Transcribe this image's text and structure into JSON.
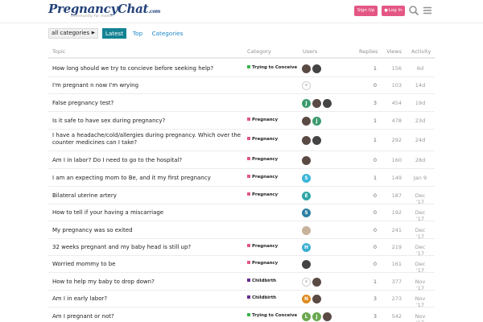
{
  "header": {
    "logo_main": "PregnancyChat",
    "logo_tld": ".com",
    "logo_tagline": "community for moms",
    "signup_label": "Sign Up",
    "login_label": "Log In"
  },
  "nav": {
    "category_dropdown": "all categories",
    "tabs": [
      "Latest",
      "Top",
      "Categories"
    ]
  },
  "columns": {
    "topic": "Topic",
    "category": "Category",
    "users": "Users",
    "replies": "Replies",
    "views": "Views",
    "activity": "Activity"
  },
  "colors": {
    "accent": "#138393",
    "button": "#e45785",
    "link": "#1e88c7",
    "cat_trying": "#3ab54a",
    "cat_pregnancy": "#e45785",
    "cat_childbirth": "#652d90"
  },
  "topics": [
    {
      "title": "How long should we try to concieve before seeking help?",
      "category": "Trying to Conceive",
      "cat_color": "#3ab54a",
      "users": [
        {
          "type": "photo",
          "letter": ""
        },
        {
          "type": "photo2",
          "letter": ""
        }
      ],
      "replies": "1",
      "views": "156",
      "activity": "6d"
    },
    {
      "title": "I'm pregnant n now I'm wrying",
      "category": "",
      "cat_color": "",
      "users": [
        {
          "type": "blank",
          "letter": ""
        }
      ],
      "replies": "0",
      "views": "103",
      "activity": "14d"
    },
    {
      "title": "False pregnancy test?",
      "category": "",
      "cat_color": "",
      "users": [
        {
          "type": "letter",
          "letter": "J",
          "color": "#3d9b6f"
        },
        {
          "type": "photo",
          "letter": ""
        },
        {
          "type": "photo2",
          "letter": ""
        }
      ],
      "replies": "3",
      "views": "454",
      "activity": "19d"
    },
    {
      "title": "Is it safe to have sex during pregnancy?",
      "category": "Pregnancy",
      "cat_color": "#e45785",
      "users": [
        {
          "type": "photo",
          "letter": ""
        },
        {
          "type": "letter",
          "letter": "J",
          "color": "#3d9b6f"
        }
      ],
      "replies": "1",
      "views": "478",
      "activity": "23d"
    },
    {
      "title": "I have a headache/cold/allergies during pregnancy. Which over the counter medicines can I take?",
      "category": "Pregnancy",
      "cat_color": "#e45785",
      "users": [
        {
          "type": "photo",
          "letter": ""
        },
        {
          "type": "photo2",
          "letter": ""
        }
      ],
      "replies": "1",
      "views": "292",
      "activity": "24d"
    },
    {
      "title": "Am I in labor? Do I need to go to the hospital?",
      "category": "Pregnancy",
      "cat_color": "#e45785",
      "users": [
        {
          "type": "photo",
          "letter": ""
        }
      ],
      "replies": "0",
      "views": "160",
      "activity": "28d"
    },
    {
      "title": "I am an expecting mom to Be, and it my first pregnancy",
      "category": "Pregnancy",
      "cat_color": "#e45785",
      "users": [
        {
          "type": "letter",
          "letter": "S",
          "color": "#3ab5d8"
        }
      ],
      "replies": "1",
      "views": "149",
      "activity": "Jan 9"
    },
    {
      "title": "Bilateral uterine artery",
      "category": "Pregnancy",
      "cat_color": "#e45785",
      "users": [
        {
          "type": "letter",
          "letter": "E",
          "color": "#2ea6a6"
        }
      ],
      "replies": "0",
      "views": "187",
      "activity": "Dec '17"
    },
    {
      "title": "How to tell if your having a miscarriage",
      "category": "",
      "cat_color": "",
      "users": [
        {
          "type": "letter",
          "letter": "S",
          "color": "#2d7fa3"
        }
      ],
      "replies": "0",
      "views": "192",
      "activity": "Dec '17"
    },
    {
      "title": "My pregnancy was so exited",
      "category": "",
      "cat_color": "",
      "users": [
        {
          "type": "photo3",
          "letter": ""
        }
      ],
      "replies": "0",
      "views": "241",
      "activity": "Dec '17"
    },
    {
      "title": "32 weeks pregnant and my baby head is still up?",
      "category": "Pregnancy",
      "cat_color": "#e45785",
      "users": [
        {
          "type": "letter",
          "letter": "H",
          "color": "#3aaed0"
        }
      ],
      "replies": "0",
      "views": "219",
      "activity": "Dec '17"
    },
    {
      "title": "Worried mommy to be",
      "category": "Pregnancy",
      "cat_color": "#e45785",
      "users": [
        {
          "type": "photo2",
          "letter": ""
        }
      ],
      "replies": "0",
      "views": "161",
      "activity": "Dec '17"
    },
    {
      "title": "How to help my baby to drop down?",
      "category": "Childbirth",
      "cat_color": "#652d90",
      "users": [
        {
          "type": "blank",
          "letter": ""
        },
        {
          "type": "photo",
          "letter": ""
        }
      ],
      "replies": "1",
      "views": "377",
      "activity": "Nov '17"
    },
    {
      "title": "Am I in early labor?",
      "category": "Childbirth",
      "cat_color": "#652d90",
      "users": [
        {
          "type": "letter",
          "letter": "N",
          "color": "#e08a1e"
        },
        {
          "type": "photo",
          "letter": ""
        }
      ],
      "replies": "3",
      "views": "273",
      "activity": "Nov '17"
    },
    {
      "title": "Am I pregnant or not?",
      "category": "Trying to Conceive",
      "cat_color": "#3ab54a",
      "users": [
        {
          "type": "letter",
          "letter": "L",
          "color": "#6aa84f"
        },
        {
          "type": "letter",
          "letter": "J",
          "color": "#6aa84f"
        },
        {
          "type": "photo",
          "letter": ""
        }
      ],
      "replies": "3",
      "views": "542",
      "activity": "Nov '17"
    }
  ]
}
